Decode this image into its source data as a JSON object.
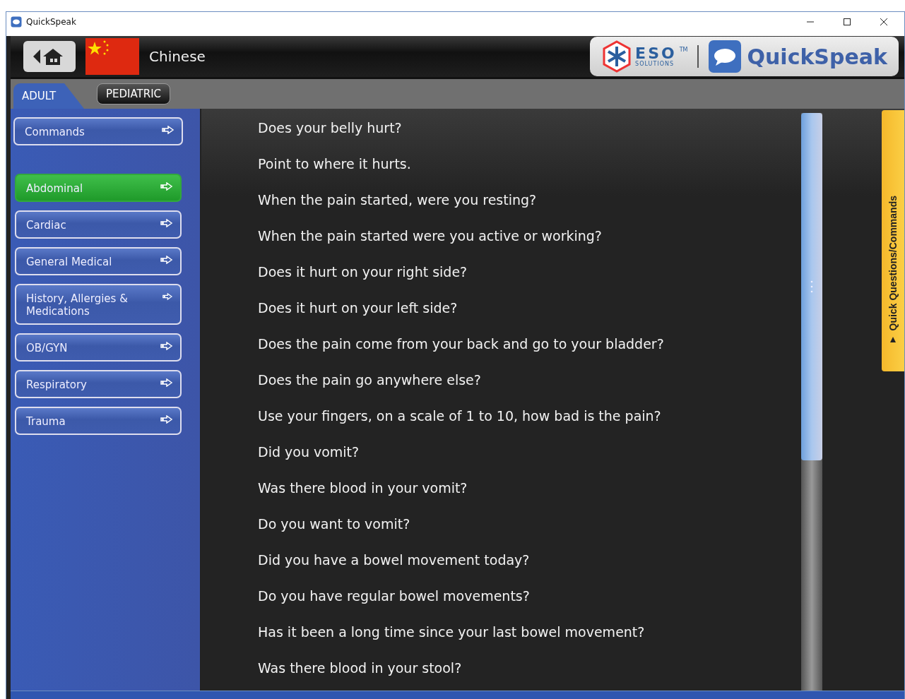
{
  "window": {
    "title": "QuickSpeak"
  },
  "header": {
    "language": "Chinese",
    "brand": "QuickSpeak",
    "partner_logo": "ESO",
    "partner_sub": "SOLUTIONS",
    "tm": "TM"
  },
  "tabs": [
    {
      "label": "ADULT",
      "selected": true
    },
    {
      "label": "PEDIATRIC",
      "selected": false
    }
  ],
  "sidebar": {
    "commands": {
      "label": "Commands",
      "selected": false
    },
    "categories": [
      {
        "label": "Abdominal",
        "selected": true
      },
      {
        "label": "Cardiac",
        "selected": false
      },
      {
        "label": "General Medical",
        "selected": false
      },
      {
        "label": "History, Allergies & Medications",
        "selected": false
      },
      {
        "label": "OB/GYN",
        "selected": false
      },
      {
        "label": "Respiratory",
        "selected": false
      },
      {
        "label": "Trauma",
        "selected": false
      }
    ]
  },
  "questions": [
    "Does your belly hurt?",
    "Point to where it hurts.",
    "When the pain started, were you resting?",
    "When the pain started were you active or working?",
    "Does it hurt on your right side?",
    "Does it hurt on your left side?",
    "Does the pain come from your back and go to your bladder?",
    "Does the pain go anywhere else?",
    "Use your fingers, on a scale of 1 to 10, how bad is the pain?",
    "Did you vomit?",
    "Was there blood in your vomit?",
    "Do you want to vomit?",
    "Did you have a bowel movement today?",
    "Do you have regular bowel movements?",
    "Has it been a long time since your last bowel movement?",
    "Was there blood in your stool?"
  ],
  "quick_panel": {
    "label": "Quick Questions/Commands"
  }
}
